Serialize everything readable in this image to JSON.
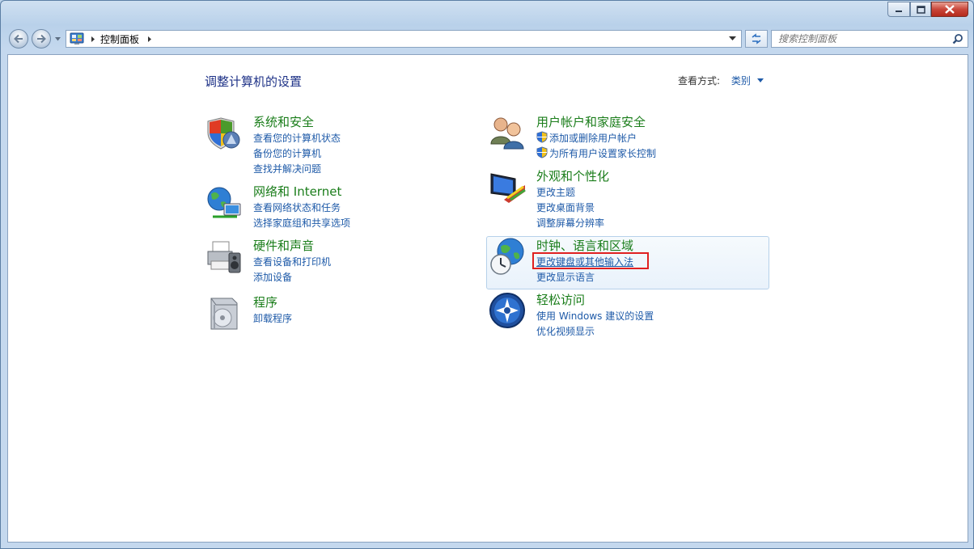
{
  "window": {
    "address": {
      "crumb": "控制面板"
    },
    "search": {
      "placeholder": "搜索控制面板"
    }
  },
  "page": {
    "title": "调整计算机的设置",
    "view_by_label": "查看方式:",
    "view_by_value": "类别"
  },
  "categories": [
    {
      "title": "系统和安全",
      "links": [
        "查看您的计算机状态",
        "备份您的计算机",
        "查找并解决问题"
      ]
    },
    {
      "title": "网络和 Internet",
      "links": [
        "查看网络状态和任务",
        "选择家庭组和共享选项"
      ]
    },
    {
      "title": "硬件和声音",
      "links": [
        "查看设备和打印机",
        "添加设备"
      ]
    },
    {
      "title": "程序",
      "links": [
        "卸载程序"
      ]
    },
    {
      "title": "用户帐户和家庭安全",
      "links": [
        "添加或删除用户帐户",
        "为所有用户设置家长控制"
      ]
    },
    {
      "title": "外观和个性化",
      "links": [
        "更改主题",
        "更改桌面背景",
        "调整屏幕分辨率"
      ]
    },
    {
      "title": "时钟、语言和区域",
      "links": [
        "更改键盘或其他输入法",
        "更改显示语言"
      ]
    },
    {
      "title": "轻松访问",
      "links": [
        "使用 Windows 建议的设置",
        "优化视频显示"
      ]
    }
  ],
  "icons": {
    "back": "back-arrow-icon",
    "forward": "forward-arrow-icon",
    "control_panel": "control-panel-icon",
    "refresh": "refresh-icon",
    "search": "search-icon",
    "minimize": "minimize-icon",
    "maximize": "maximize-icon",
    "close": "close-icon"
  },
  "colors": {
    "category_title": "#1a7d1a",
    "link": "#1e5aa8",
    "page_title": "#1e3287",
    "highlight": "#e02020"
  }
}
